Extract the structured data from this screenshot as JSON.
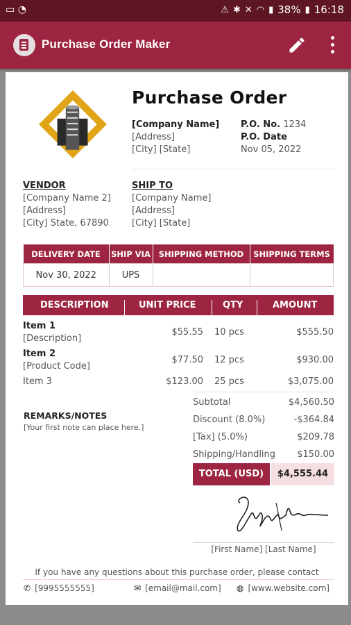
{
  "status_bar": {
    "time": "16:18",
    "battery": "38%"
  },
  "app_bar": {
    "title": "Purchase Order Maker"
  },
  "document": {
    "title": "Purchase Order",
    "company": {
      "name": "[Company Name]",
      "address": "[Address]",
      "city_state": "[City] [State]"
    },
    "po": {
      "no_label": "P.O. No.",
      "no_value": "1234",
      "date_label": "P.O. Date",
      "date_value": "Nov 05, 2022"
    },
    "vendor": {
      "heading": "VENDOR",
      "name": "[Company Name 2]",
      "address": "[Address]",
      "city": "[City] State, 67890"
    },
    "ship_to": {
      "heading": "SHIP TO",
      "name": "[Company Name]",
      "address": "[Address]",
      "city": "[City] [State]"
    },
    "shipping": {
      "headers": [
        "DELIVERY DATE",
        "SHIP VIA",
        "SHIPPING METHOD",
        "SHIPPING TERMS"
      ],
      "values": [
        "Nov 30, 2022",
        "UPS",
        "",
        ""
      ]
    },
    "items": {
      "headers": {
        "description": "DESCRIPTION",
        "unit_price": "UNIT PRICE",
        "qty": "QTY",
        "amount": "AMOUNT"
      },
      "rows": [
        {
          "name": "Item 1",
          "sub": "[Description]",
          "unit_price": "$55.55",
          "qty": "10 pcs",
          "amount": "$555.50"
        },
        {
          "name": "Item 2",
          "sub": "[Product Code]",
          "unit_price": "$77.50",
          "qty": "12 pcs",
          "amount": "$930.00"
        },
        {
          "name": "Item 3",
          "sub": "",
          "unit_price": "$123.00",
          "qty": "25 pcs",
          "amount": "$3,075.00"
        }
      ]
    },
    "remarks": {
      "title": "REMARKS/NOTES",
      "note": "[Your first note can place here.]"
    },
    "totals": {
      "subtotal_label": "Subtotal",
      "subtotal": "$4,560.50",
      "discount_label": "Discount (8.0%)",
      "discount": "-$364.84",
      "tax_label": "[Tax] (5.0%)",
      "tax": "$209.78",
      "shipping_label": "Shipping/Handling",
      "shipping": "$150.00",
      "total_label": "TOTAL (USD)",
      "total": "$4,555.44"
    },
    "signature": {
      "name": "[First Name] [Last Name]"
    },
    "footer": {
      "question": "If you have any questions about this purchase order, please contact",
      "phone": "[9995555555]",
      "email": "[email@mail.com]",
      "website": "[www.website.com]"
    }
  },
  "colors": {
    "primary": "#9e2541",
    "status_bar": "#5e1524",
    "total_bg": "#f5dfe2",
    "logo_gold": "#e0a416"
  }
}
